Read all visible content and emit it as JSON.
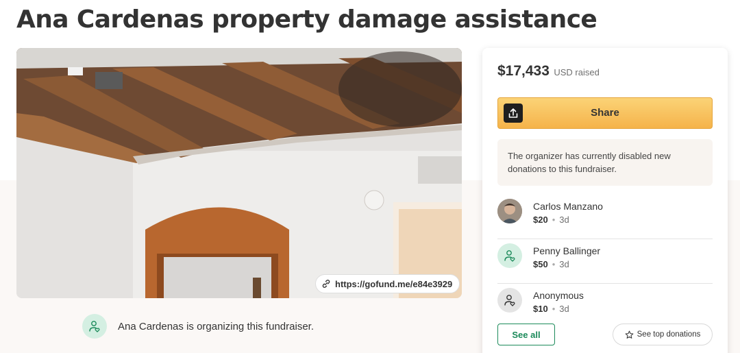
{
  "page": {
    "title": "Ana Cardenas property damage assistance"
  },
  "photo": {
    "short_link": "https://gofund.me/e84e3929"
  },
  "organizer": {
    "text": "Ana Cardenas is organizing this fundraiser."
  },
  "sidebar": {
    "raised_amount": "$17,433",
    "raised_label": "USD raised",
    "share_label": "Share",
    "notice": "The organizer has currently disabled new donations to this fundraiser.",
    "donations": [
      {
        "name": "Carlos Manzano",
        "amount": "$20",
        "time": "3d",
        "avatar": "photo"
      },
      {
        "name": "Penny Ballinger",
        "amount": "$50",
        "time": "3d",
        "avatar": "heart-hand-icon"
      },
      {
        "name": "Anonymous",
        "amount": "$10",
        "time": "3d",
        "avatar": "heart-hand-icon"
      }
    ],
    "see_all_label": "See all",
    "see_top_label": "See top donations"
  },
  "colors": {
    "share_button": "#f5b34a",
    "accent_green": "#1b8a5a",
    "green_avatar_bg": "#d4efe2",
    "page_band": "#fbf8f6"
  }
}
